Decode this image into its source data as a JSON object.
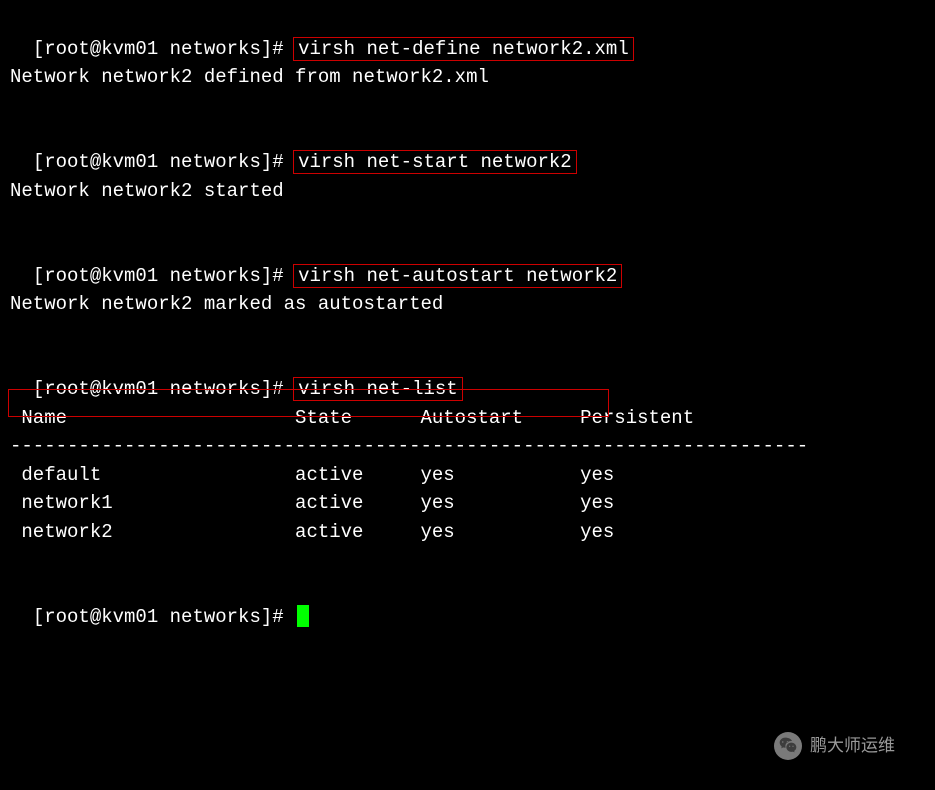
{
  "prompts": {
    "p1": "[root@kvm01 networks]# ",
    "p2": "[root@kvm01 networks]# ",
    "p3": "[root@kvm01 networks]# ",
    "p4": "[root@kvm01 networks]# ",
    "p5": "[root@kvm01 networks]# "
  },
  "commands": {
    "c1": "virsh net-define network2.xml",
    "c2": "virsh net-start network2",
    "c3": "virsh net-autostart network2",
    "c4": "virsh net-list"
  },
  "outputs": {
    "o1": "Network network2 defined from network2.xml",
    "o2": "Network network2 started",
    "o3": "Network network2 marked as autostarted"
  },
  "table": {
    "header": " Name                    State      Autostart     Persistent",
    "divider": "----------------------------------------------------------------------",
    "rows": [
      " default                 active     yes           yes",
      " network1                active     yes           yes",
      " network2                active     yes           yes"
    ]
  },
  "watermark": {
    "text": "鹏大师运维"
  }
}
